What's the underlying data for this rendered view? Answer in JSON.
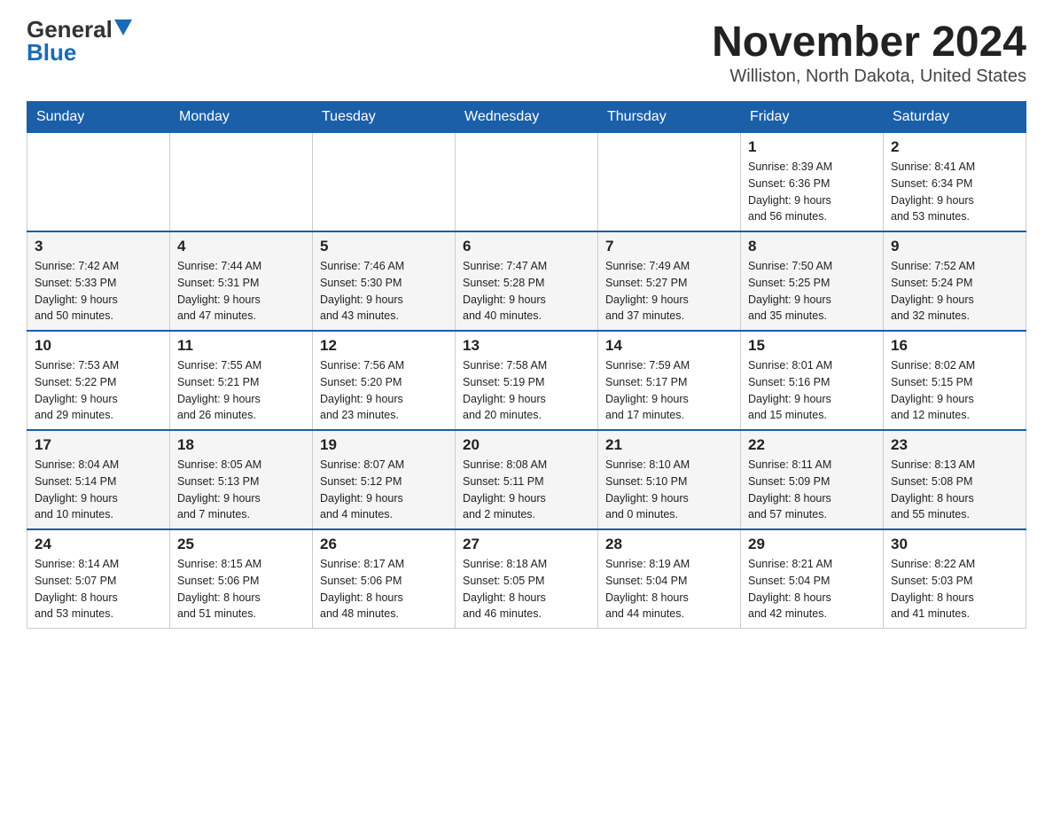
{
  "header": {
    "logo_general": "General",
    "logo_blue": "Blue",
    "month_year": "November 2024",
    "location": "Williston, North Dakota, United States"
  },
  "days_of_week": [
    "Sunday",
    "Monday",
    "Tuesday",
    "Wednesday",
    "Thursday",
    "Friday",
    "Saturday"
  ],
  "weeks": [
    [
      {
        "day": "",
        "info": ""
      },
      {
        "day": "",
        "info": ""
      },
      {
        "day": "",
        "info": ""
      },
      {
        "day": "",
        "info": ""
      },
      {
        "day": "",
        "info": ""
      },
      {
        "day": "1",
        "info": "Sunrise: 8:39 AM\nSunset: 6:36 PM\nDaylight: 9 hours\nand 56 minutes."
      },
      {
        "day": "2",
        "info": "Sunrise: 8:41 AM\nSunset: 6:34 PM\nDaylight: 9 hours\nand 53 minutes."
      }
    ],
    [
      {
        "day": "3",
        "info": "Sunrise: 7:42 AM\nSunset: 5:33 PM\nDaylight: 9 hours\nand 50 minutes."
      },
      {
        "day": "4",
        "info": "Sunrise: 7:44 AM\nSunset: 5:31 PM\nDaylight: 9 hours\nand 47 minutes."
      },
      {
        "day": "5",
        "info": "Sunrise: 7:46 AM\nSunset: 5:30 PM\nDaylight: 9 hours\nand 43 minutes."
      },
      {
        "day": "6",
        "info": "Sunrise: 7:47 AM\nSunset: 5:28 PM\nDaylight: 9 hours\nand 40 minutes."
      },
      {
        "day": "7",
        "info": "Sunrise: 7:49 AM\nSunset: 5:27 PM\nDaylight: 9 hours\nand 37 minutes."
      },
      {
        "day": "8",
        "info": "Sunrise: 7:50 AM\nSunset: 5:25 PM\nDaylight: 9 hours\nand 35 minutes."
      },
      {
        "day": "9",
        "info": "Sunrise: 7:52 AM\nSunset: 5:24 PM\nDaylight: 9 hours\nand 32 minutes."
      }
    ],
    [
      {
        "day": "10",
        "info": "Sunrise: 7:53 AM\nSunset: 5:22 PM\nDaylight: 9 hours\nand 29 minutes."
      },
      {
        "day": "11",
        "info": "Sunrise: 7:55 AM\nSunset: 5:21 PM\nDaylight: 9 hours\nand 26 minutes."
      },
      {
        "day": "12",
        "info": "Sunrise: 7:56 AM\nSunset: 5:20 PM\nDaylight: 9 hours\nand 23 minutes."
      },
      {
        "day": "13",
        "info": "Sunrise: 7:58 AM\nSunset: 5:19 PM\nDaylight: 9 hours\nand 20 minutes."
      },
      {
        "day": "14",
        "info": "Sunrise: 7:59 AM\nSunset: 5:17 PM\nDaylight: 9 hours\nand 17 minutes."
      },
      {
        "day": "15",
        "info": "Sunrise: 8:01 AM\nSunset: 5:16 PM\nDaylight: 9 hours\nand 15 minutes."
      },
      {
        "day": "16",
        "info": "Sunrise: 8:02 AM\nSunset: 5:15 PM\nDaylight: 9 hours\nand 12 minutes."
      }
    ],
    [
      {
        "day": "17",
        "info": "Sunrise: 8:04 AM\nSunset: 5:14 PM\nDaylight: 9 hours\nand 10 minutes."
      },
      {
        "day": "18",
        "info": "Sunrise: 8:05 AM\nSunset: 5:13 PM\nDaylight: 9 hours\nand 7 minutes."
      },
      {
        "day": "19",
        "info": "Sunrise: 8:07 AM\nSunset: 5:12 PM\nDaylight: 9 hours\nand 4 minutes."
      },
      {
        "day": "20",
        "info": "Sunrise: 8:08 AM\nSunset: 5:11 PM\nDaylight: 9 hours\nand 2 minutes."
      },
      {
        "day": "21",
        "info": "Sunrise: 8:10 AM\nSunset: 5:10 PM\nDaylight: 9 hours\nand 0 minutes."
      },
      {
        "day": "22",
        "info": "Sunrise: 8:11 AM\nSunset: 5:09 PM\nDaylight: 8 hours\nand 57 minutes."
      },
      {
        "day": "23",
        "info": "Sunrise: 8:13 AM\nSunset: 5:08 PM\nDaylight: 8 hours\nand 55 minutes."
      }
    ],
    [
      {
        "day": "24",
        "info": "Sunrise: 8:14 AM\nSunset: 5:07 PM\nDaylight: 8 hours\nand 53 minutes."
      },
      {
        "day": "25",
        "info": "Sunrise: 8:15 AM\nSunset: 5:06 PM\nDaylight: 8 hours\nand 51 minutes."
      },
      {
        "day": "26",
        "info": "Sunrise: 8:17 AM\nSunset: 5:06 PM\nDaylight: 8 hours\nand 48 minutes."
      },
      {
        "day": "27",
        "info": "Sunrise: 8:18 AM\nSunset: 5:05 PM\nDaylight: 8 hours\nand 46 minutes."
      },
      {
        "day": "28",
        "info": "Sunrise: 8:19 AM\nSunset: 5:04 PM\nDaylight: 8 hours\nand 44 minutes."
      },
      {
        "day": "29",
        "info": "Sunrise: 8:21 AM\nSunset: 5:04 PM\nDaylight: 8 hours\nand 42 minutes."
      },
      {
        "day": "30",
        "info": "Sunrise: 8:22 AM\nSunset: 5:03 PM\nDaylight: 8 hours\nand 41 minutes."
      }
    ]
  ]
}
